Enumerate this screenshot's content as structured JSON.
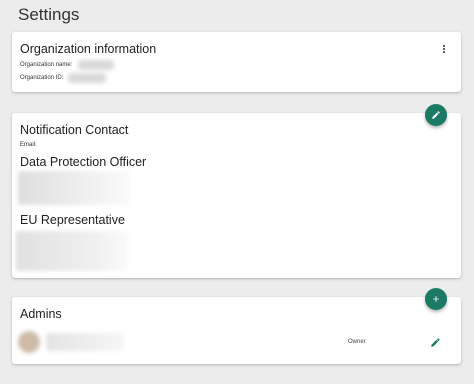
{
  "page": {
    "title": "Settings"
  },
  "organization": {
    "title": "Organization information",
    "name_label": "Organization name:",
    "id_label": "Organization ID:",
    "menu_icon": "more-vertical-icon"
  },
  "contact": {
    "title": "Notification Contact",
    "email_label": "Email:",
    "dpo_title": "Data Protection Officer",
    "eu_title": "EU Representative",
    "edit_icon": "pencil-icon"
  },
  "admins": {
    "title": "Admins",
    "add_icon": "plus-icon",
    "rows": [
      {
        "role": "Owner",
        "edit_icon": "pencil-icon"
      }
    ]
  },
  "colors": {
    "accent": "#1b7a64",
    "background": "#ececec",
    "card": "#ffffff"
  }
}
